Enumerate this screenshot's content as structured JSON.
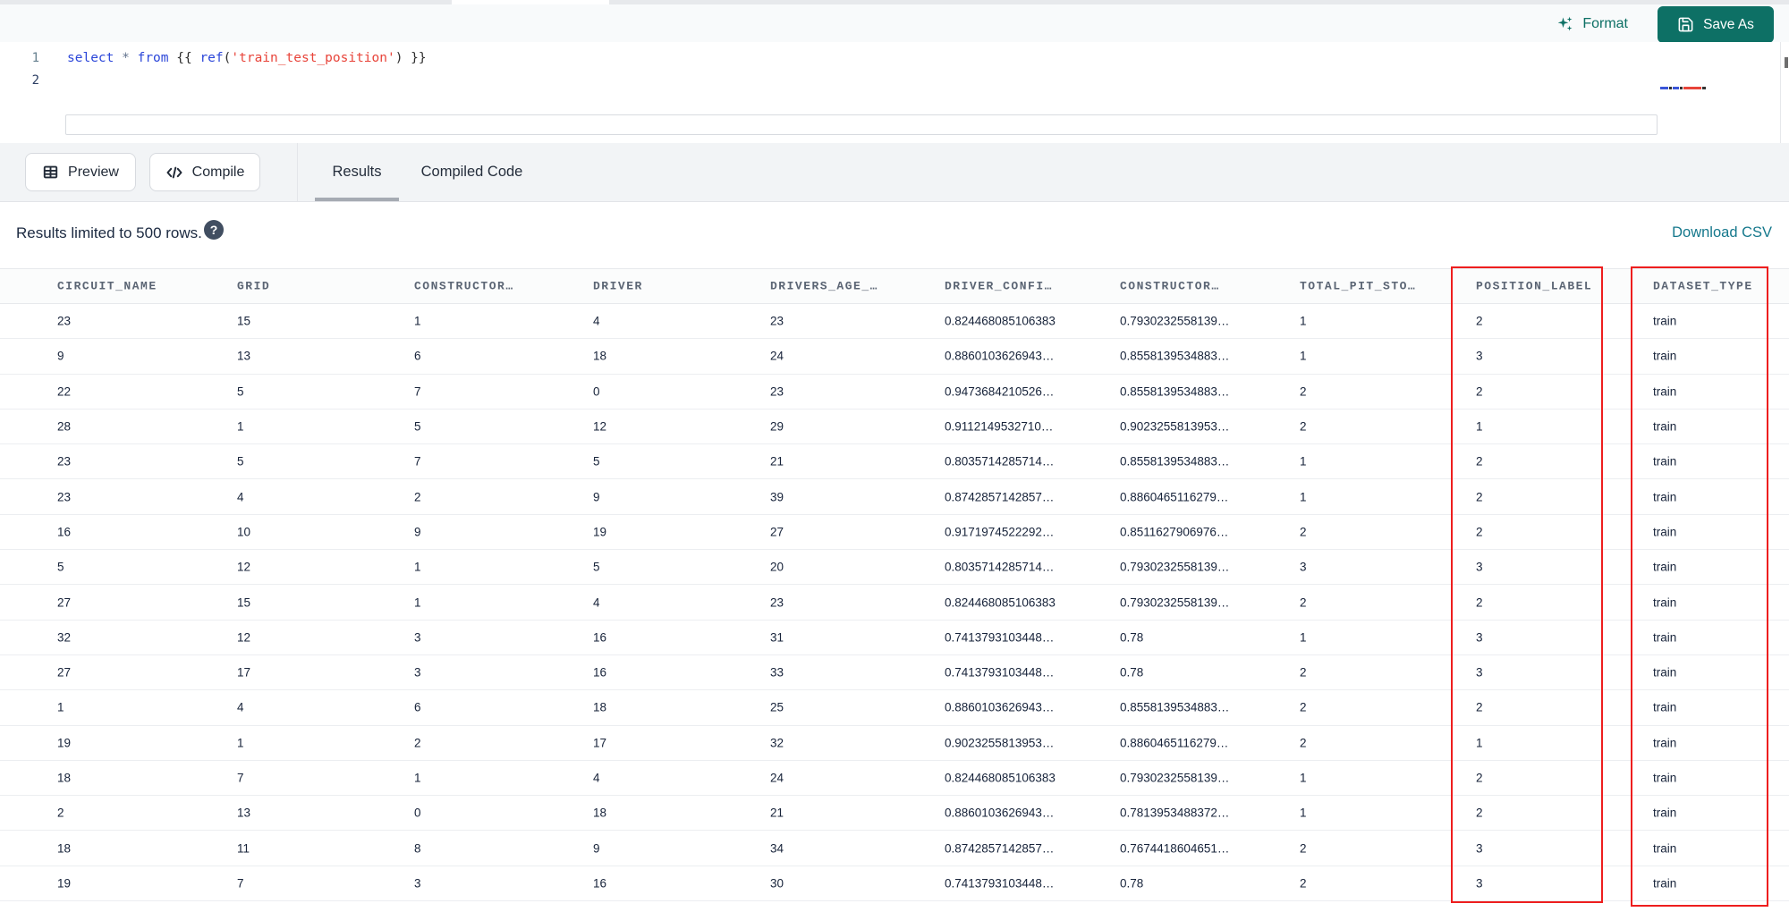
{
  "colors": {
    "accent_teal": "#0d7065",
    "link_teal": "#15788c",
    "highlight_red": "#ee1e1e",
    "keyword_blue": "#2b46d9",
    "string_red": "#e8443a"
  },
  "top_toolbar": {
    "format_label": "Format",
    "save_as_label": "Save As"
  },
  "editor": {
    "lines": [
      {
        "number": "1",
        "active": false,
        "tokens": [
          {
            "text": "select",
            "type": "keyword"
          },
          {
            "text": " ",
            "type": "plain"
          },
          {
            "text": "*",
            "type": "operator"
          },
          {
            "text": " ",
            "type": "plain"
          },
          {
            "text": "from",
            "type": "keyword"
          },
          {
            "text": " ",
            "type": "plain"
          },
          {
            "text": "{{ ",
            "type": "brace"
          },
          {
            "text": "ref",
            "type": "function"
          },
          {
            "text": "(",
            "type": "paren"
          },
          {
            "text": "'train_test_position'",
            "type": "string"
          },
          {
            "text": ")",
            "type": "paren"
          },
          {
            "text": " }}",
            "type": "brace"
          }
        ]
      },
      {
        "number": "2",
        "active": true,
        "tokens": []
      }
    ],
    "minimap_segments": [
      {
        "width": 9,
        "color": "#3a55d8"
      },
      {
        "width": 3,
        "color": "#333333"
      },
      {
        "width": 7,
        "color": "#3a55d8"
      },
      {
        "width": 3,
        "color": "#333333"
      },
      {
        "width": 20,
        "color": "#e8443a"
      },
      {
        "width": 4,
        "color": "#333333"
      }
    ]
  },
  "action_bar": {
    "preview_label": "Preview",
    "compile_label": "Compile",
    "tabs": [
      {
        "label": "Results",
        "active": true
      },
      {
        "label": "Compiled Code",
        "active": false
      }
    ]
  },
  "results_bar": {
    "limit_text": "Results limited to 500 rows.",
    "help_glyph": "?",
    "download_label": "Download CSV"
  },
  "table": {
    "columns": [
      "CIRCUIT_NAME",
      "GRID",
      "CONSTRUCTOR…",
      "DRIVER",
      "DRIVERS_AGE_…",
      "DRIVER_CONFI…",
      "CONSTRUCTOR…",
      "TOTAL_PIT_STO…",
      "POSITION_LABEL",
      "DATASET_TYPE"
    ],
    "highlighted_columns": [
      "POSITION_LABEL",
      "DATASET_TYPE"
    ],
    "rows": [
      [
        "23",
        "15",
        "1",
        "4",
        "23",
        "0.824468085106383",
        "0.7930232558139…",
        "1",
        "2",
        "train"
      ],
      [
        "9",
        "13",
        "6",
        "18",
        "24",
        "0.8860103626943…",
        "0.8558139534883…",
        "1",
        "3",
        "train"
      ],
      [
        "22",
        "5",
        "7",
        "0",
        "23",
        "0.9473684210526…",
        "0.8558139534883…",
        "2",
        "2",
        "train"
      ],
      [
        "28",
        "1",
        "5",
        "12",
        "29",
        "0.9112149532710…",
        "0.9023255813953…",
        "2",
        "1",
        "train"
      ],
      [
        "23",
        "5",
        "7",
        "5",
        "21",
        "0.8035714285714…",
        "0.8558139534883…",
        "1",
        "2",
        "train"
      ],
      [
        "23",
        "4",
        "2",
        "9",
        "39",
        "0.8742857142857…",
        "0.8860465116279…",
        "1",
        "2",
        "train"
      ],
      [
        "16",
        "10",
        "9",
        "19",
        "27",
        "0.9171974522292…",
        "0.8511627906976…",
        "2",
        "2",
        "train"
      ],
      [
        "5",
        "12",
        "1",
        "5",
        "20",
        "0.8035714285714…",
        "0.7930232558139…",
        "3",
        "3",
        "train"
      ],
      [
        "27",
        "15",
        "1",
        "4",
        "23",
        "0.824468085106383",
        "0.7930232558139…",
        "2",
        "2",
        "train"
      ],
      [
        "32",
        "12",
        "3",
        "16",
        "31",
        "0.7413793103448…",
        "0.78",
        "1",
        "3",
        "train"
      ],
      [
        "27",
        "17",
        "3",
        "16",
        "33",
        "0.7413793103448…",
        "0.78",
        "2",
        "3",
        "train"
      ],
      [
        "1",
        "4",
        "6",
        "18",
        "25",
        "0.8860103626943…",
        "0.8558139534883…",
        "2",
        "2",
        "train"
      ],
      [
        "19",
        "1",
        "2",
        "17",
        "32",
        "0.9023255813953…",
        "0.8860465116279…",
        "2",
        "1",
        "train"
      ],
      [
        "18",
        "7",
        "1",
        "4",
        "24",
        "0.824468085106383",
        "0.7930232558139…",
        "1",
        "2",
        "train"
      ],
      [
        "2",
        "13",
        "0",
        "18",
        "21",
        "0.8860103626943…",
        "0.7813953488372…",
        "1",
        "2",
        "train"
      ],
      [
        "18",
        "11",
        "8",
        "9",
        "34",
        "0.8742857142857…",
        "0.7674418604651…",
        "2",
        "3",
        "train"
      ],
      [
        "19",
        "7",
        "3",
        "16",
        "30",
        "0.7413793103448…",
        "0.78",
        "2",
        "3",
        "train"
      ]
    ]
  }
}
